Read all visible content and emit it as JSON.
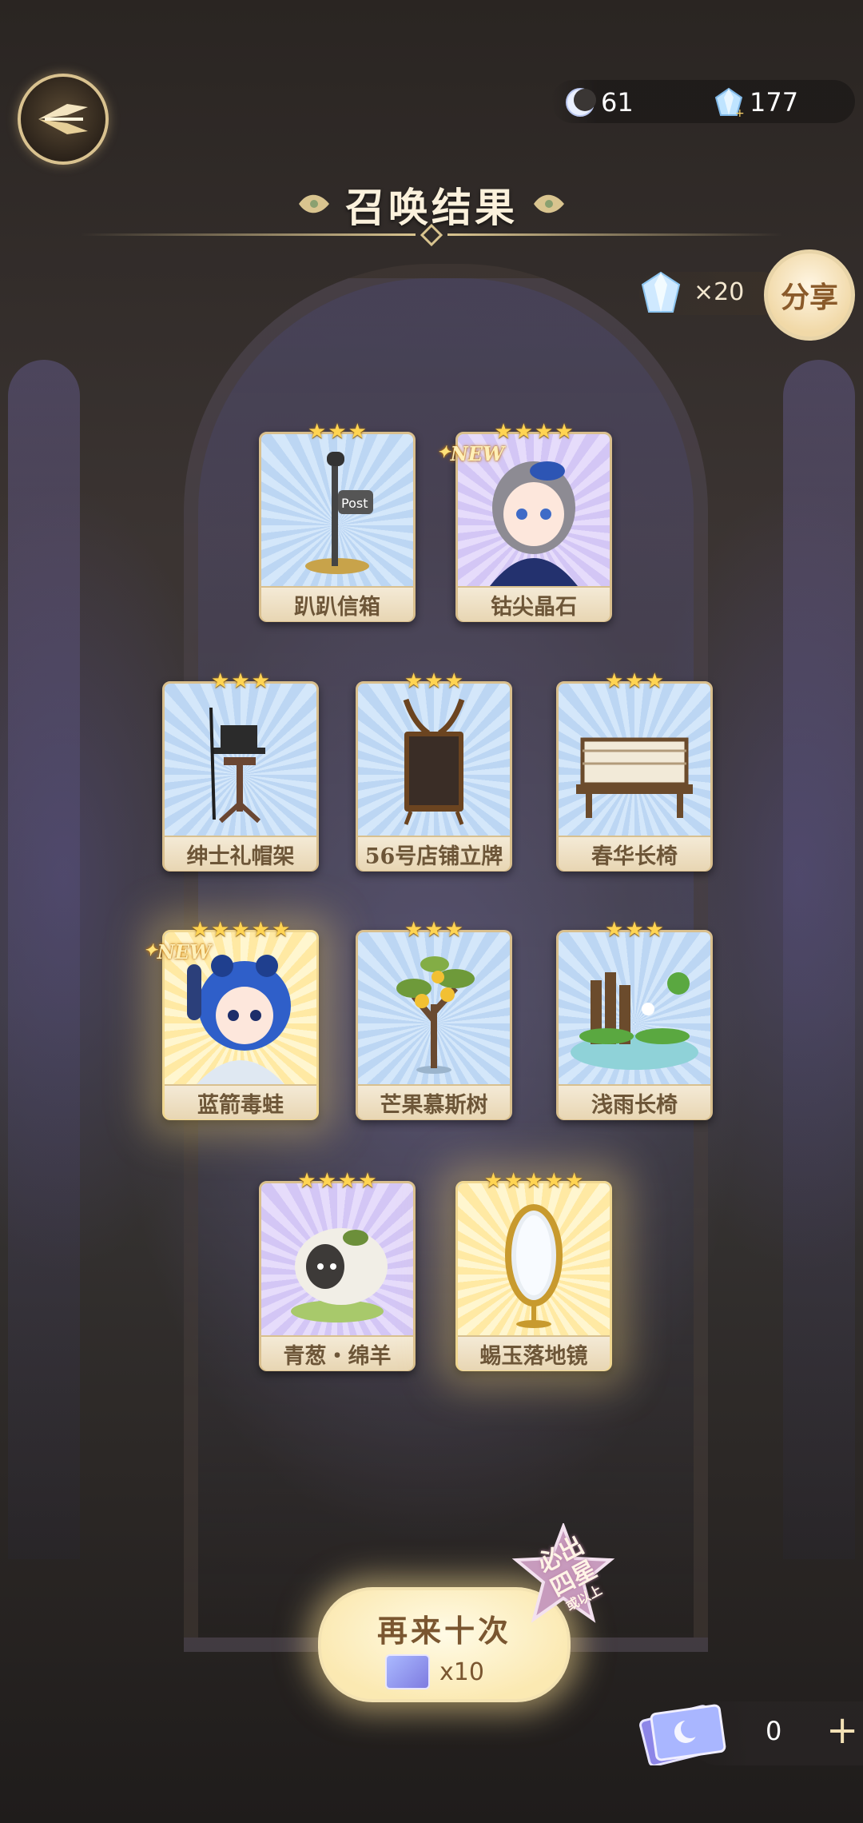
{
  "header": {
    "moon_currency": "61",
    "crystal_currency": "177",
    "title": "召唤结果"
  },
  "share": {
    "reward_count": "×20",
    "button_label": "分享"
  },
  "cards": [
    {
      "name": "趴趴信箱",
      "stars": 3,
      "is_new": false,
      "rarity": "r3",
      "icon": "mailbox-art"
    },
    {
      "name": "钴尖晶石",
      "stars": 4,
      "is_new": true,
      "rarity": "r4",
      "icon": "character-girl-art"
    },
    {
      "name": "绅士礼帽架",
      "stars": 3,
      "is_new": false,
      "rarity": "r3",
      "icon": "hat-stand-art"
    },
    {
      "name": "56号店铺立牌",
      "stars": 3,
      "is_new": false,
      "rarity": "r3",
      "icon": "shop-sign-art"
    },
    {
      "name": "春华长椅",
      "stars": 3,
      "is_new": false,
      "rarity": "r3",
      "icon": "bench-art"
    },
    {
      "name": "蓝箭毒蛙",
      "stars": 5,
      "is_new": true,
      "rarity": "r5",
      "icon": "character-frog-art"
    },
    {
      "name": "芒果慕斯树",
      "stars": 3,
      "is_new": false,
      "rarity": "r3",
      "icon": "mango-tree-art"
    },
    {
      "name": "浅雨长椅",
      "stars": 3,
      "is_new": false,
      "rarity": "r3",
      "icon": "lotus-bench-art"
    },
    {
      "name": "青葱・绵羊",
      "stars": 4,
      "is_new": false,
      "rarity": "r4",
      "icon": "sheep-art"
    },
    {
      "name": "蜴玉落地镜",
      "stars": 5,
      "is_new": false,
      "rarity": "r5",
      "icon": "mirror-art"
    }
  ],
  "new_tag": "NEW",
  "bottom": {
    "again_label": "再来十次",
    "again_cost": "x10",
    "badge_line1": "必出",
    "badge_line2": "四星",
    "badge_line3": "或以上",
    "ticket_count": "0",
    "plus_label": "+"
  }
}
